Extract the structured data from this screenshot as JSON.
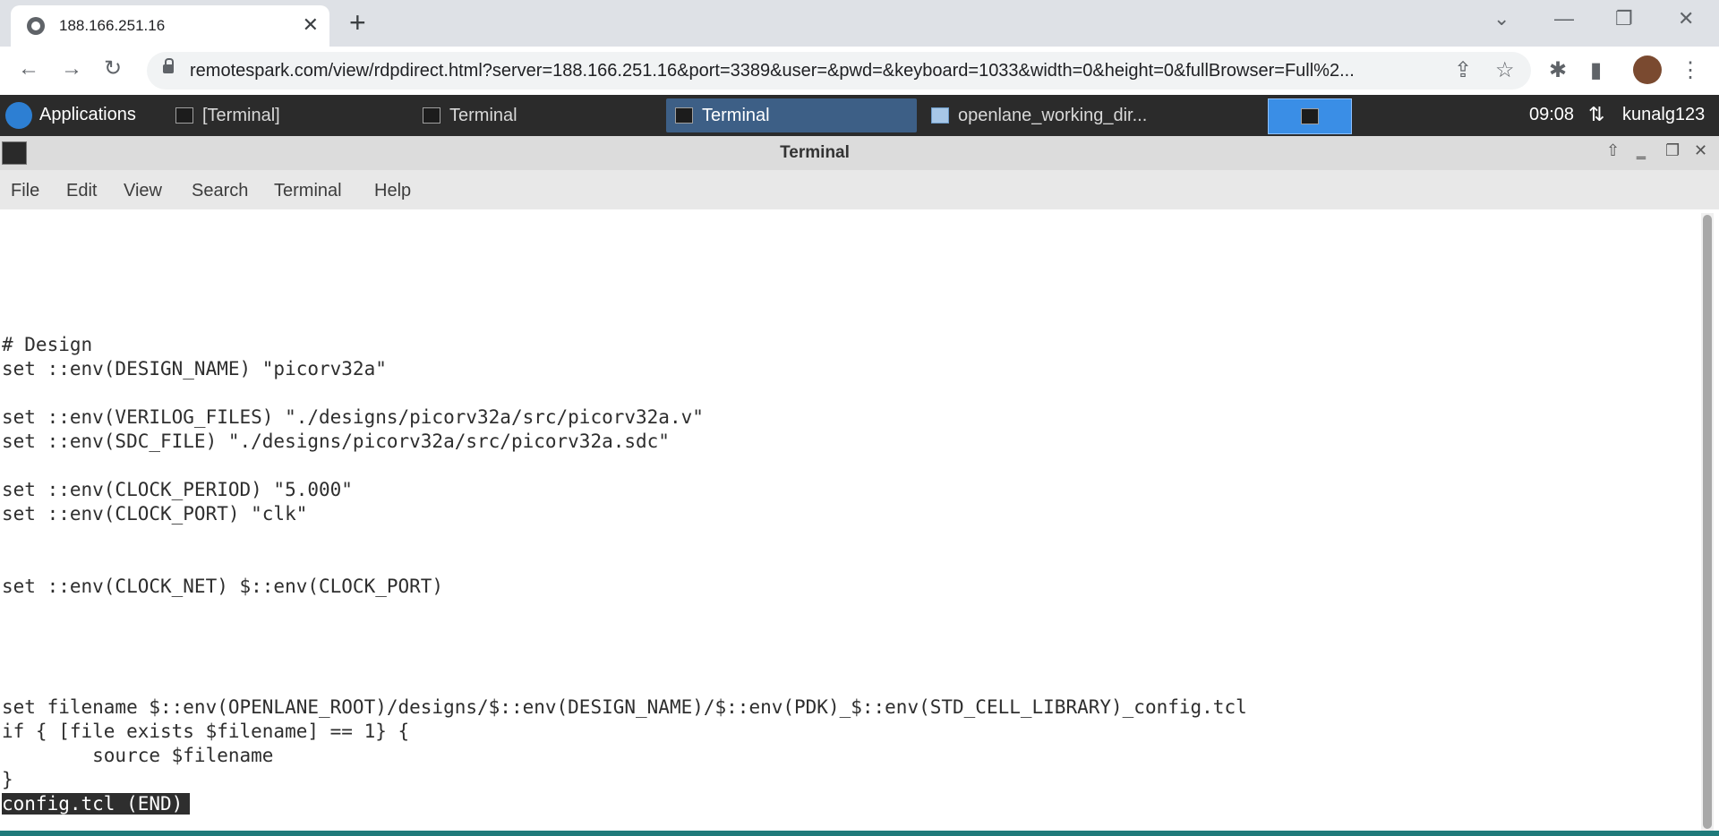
{
  "browser": {
    "tab_title": "188.166.251.16",
    "url": "remotespark.com/view/rdpdirect.html?server=188.166.251.16&port=3389&user=&pwd=&keyboard=1033&width=0&height=0&fullBrowser=Full%2...",
    "tab_close": "✕",
    "new_tab": "+",
    "back": "←",
    "forward": "→",
    "reload": "↻",
    "share": "⇪",
    "bookmark": "☆",
    "menu": "⋮",
    "minimize": "—",
    "restore": "❐",
    "close": "✕",
    "dropdown": "⌄"
  },
  "panel": {
    "applications": "Applications",
    "tasks": [
      {
        "label": "[Terminal]"
      },
      {
        "label": "Terminal"
      },
      {
        "label": "Terminal"
      },
      {
        "label": "openlane_working_dir..."
      }
    ],
    "clock": "09:08",
    "user": "kunalg123"
  },
  "window": {
    "title": "Terminal",
    "menu": [
      "File",
      "Edit",
      "View",
      "Search",
      "Terminal",
      "Help"
    ]
  },
  "terminal": {
    "lines": [
      "# Design",
      "set ::env(DESIGN_NAME) \"picorv32a\"",
      "set ::env(VERILOG_FILES) \"./designs/picorv32a/src/picorv32a.v\"",
      "set ::env(SDC_FILE) \"./designs/picorv32a/src/picorv32a.sdc\"",
      "set ::env(CLOCK_PERIOD) \"5.000\"",
      "set ::env(CLOCK_PORT) \"clk\"",
      "set ::env(CLOCK_NET) $::env(CLOCK_PORT)",
      "set filename $::env(OPENLANE_ROOT)/designs/$::env(DESIGN_NAME)/$::env(PDK)_$::env(STD_CELL_LIBRARY)_config.tcl",
      "if { [file exists $filename] == 1} {",
      "        source $filename",
      "}"
    ],
    "status": "config.tcl (END)"
  },
  "icons": {
    "tab_favicon": "globe-icon",
    "lock": "lock-icon",
    "extensions": "puzzle-icon",
    "sidebar": "side-panel-icon",
    "profile": "avatar",
    "xfce": "xfce-mouse-icon",
    "terminal": "terminal-icon",
    "folder": "folder-icon",
    "network": "network-icon"
  }
}
